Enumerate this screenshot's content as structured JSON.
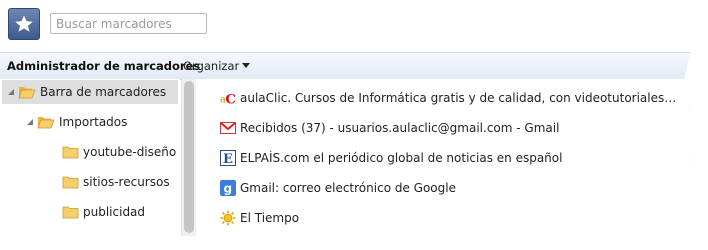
{
  "search": {
    "placeholder": "Buscar marcadores"
  },
  "toolbar": {
    "title": "Administrador de marcadores",
    "organize_label": "Organizar"
  },
  "tree": {
    "items": [
      {
        "label": "Barra de marcadores"
      },
      {
        "label": "Importados"
      },
      {
        "label": "youtube-diseño"
      },
      {
        "label": "sitios-recursos"
      },
      {
        "label": "publicidad"
      }
    ]
  },
  "bookmarks": {
    "items": [
      {
        "icon": "aulaclic-favicon",
        "title": "aulaClic. Cursos de Informática gratis y de calidad, con videotutoriales. Cursos de ..."
      },
      {
        "icon": "gmail-favicon",
        "title": "Recibidos (37) - usuarios.aulaclic@gmail.com - Gmail"
      },
      {
        "icon": "elpais-favicon",
        "title": "ELPAÍS.com el periódico global de noticias en español"
      },
      {
        "icon": "google-favicon",
        "title": "Gmail: correo electrónico de Google"
      },
      {
        "icon": "eltiempo-favicon",
        "title": "El Tiempo"
      }
    ]
  },
  "colors": {
    "toolbar_bg": "#e3eaf4",
    "star_button": "#4a6499",
    "folder": "#f4c45c",
    "selected": "#dedede"
  }
}
